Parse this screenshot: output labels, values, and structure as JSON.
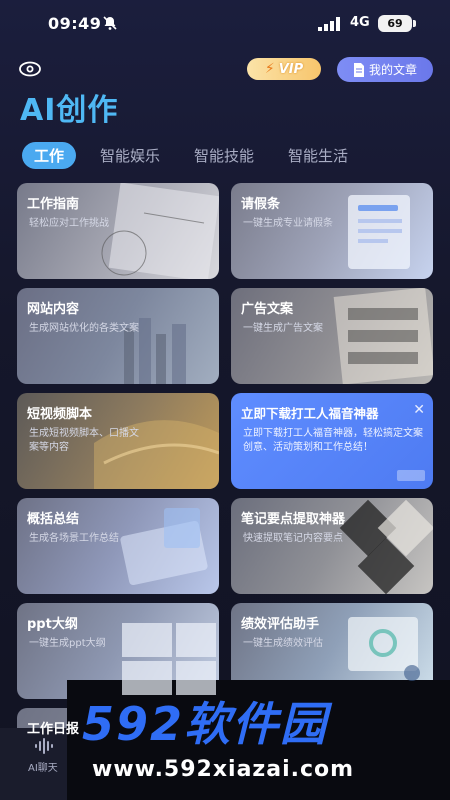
{
  "status_bar": {
    "time": "09:49",
    "network": "4G",
    "battery": "69",
    "icons": [
      "mute-icon",
      "signal-icon"
    ]
  },
  "header": {
    "vip_label": "VIP",
    "my_articles_label": "我的文章",
    "title": "AI创作"
  },
  "tabs": [
    {
      "label": "工作"
    },
    {
      "label": "智能娱乐"
    },
    {
      "label": "智能技能"
    },
    {
      "label": "智能生活"
    }
  ],
  "cards": [
    {
      "title": "工作指南",
      "desc": "轻松应对工作挑战"
    },
    {
      "title": "请假条",
      "desc": "一键生成专业请假条"
    },
    {
      "title": "网站内容",
      "desc": "生成网站优化的各类文案"
    },
    {
      "title": "广告文案",
      "desc": "一键生成广告文案"
    },
    {
      "title": "短视频脚本",
      "desc": "生成短视频脚本、口播文案等内容"
    },
    {
      "title": "立即下载打工人福音神器",
      "desc": "立即下载打工人福音神器，轻松搞定文案创意、活动策划和工作总结！"
    },
    {
      "title": "概括总结",
      "desc": "生成各场景工作总结"
    },
    {
      "title": "笔记要点提取神器",
      "desc": "快速提取笔记内容要点"
    },
    {
      "title": "ppt大纲",
      "desc": "一键生成ppt大纲"
    },
    {
      "title": "绩效评估助手",
      "desc": "一键生成绩效评估"
    },
    {
      "title": "工作日报",
      "desc": ""
    }
  ],
  "bottom_nav": {
    "ai_chat_label": "AI聊天"
  },
  "watermark": {
    "logo": "592软件园",
    "url": "www.592xiazai.com"
  },
  "colors": {
    "background": "#15172b",
    "accent": "#4aa9f0",
    "title": "#4fb8f4",
    "ad_card": "#5f8dff"
  }
}
